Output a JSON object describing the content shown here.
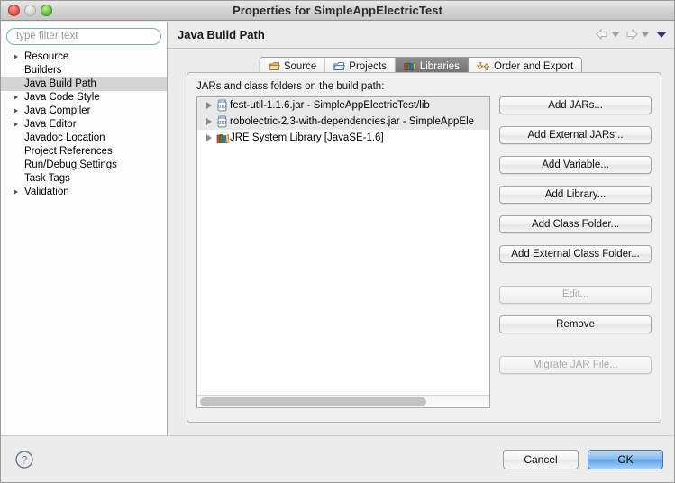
{
  "window": {
    "title": "Properties for SimpleAppElectricTest",
    "controls": [
      "close",
      "minimize",
      "zoom"
    ]
  },
  "sidebar": {
    "filter": {
      "placeholder": "type filter text",
      "value": ""
    },
    "items": [
      {
        "label": "Resource",
        "expandable": true,
        "selected": false
      },
      {
        "label": "Builders",
        "expandable": false,
        "selected": false
      },
      {
        "label": "Java Build Path",
        "expandable": false,
        "selected": true
      },
      {
        "label": "Java Code Style",
        "expandable": true,
        "selected": false
      },
      {
        "label": "Java Compiler",
        "expandable": true,
        "selected": false
      },
      {
        "label": "Java Editor",
        "expandable": true,
        "selected": false
      },
      {
        "label": "Javadoc Location",
        "expandable": false,
        "selected": false
      },
      {
        "label": "Project References",
        "expandable": false,
        "selected": false
      },
      {
        "label": "Run/Debug Settings",
        "expandable": false,
        "selected": false
      },
      {
        "label": "Task Tags",
        "expandable": false,
        "selected": false
      },
      {
        "label": "Validation",
        "expandable": true,
        "selected": false
      }
    ]
  },
  "page": {
    "title": "Java Build Path",
    "nav": {
      "back_icon": "back-arrow-icon",
      "forward_icon": "forward-arrow-icon",
      "menu_icon": "view-menu-icon"
    }
  },
  "tabs": [
    {
      "label": "Source",
      "icon": "source-folder-icon",
      "active": false
    },
    {
      "label": "Projects",
      "icon": "projects-folder-icon",
      "active": false
    },
    {
      "label": "Libraries",
      "icon": "books-icon",
      "active": true
    },
    {
      "label": "Order and Export",
      "icon": "order-export-icon",
      "active": false
    }
  ],
  "libraries": {
    "group_label": "JARs and class folders on the build path:",
    "entries": [
      {
        "label": "fest-util-1.1.6.jar - SimpleAppElectricTest/lib",
        "icon": "jar-icon",
        "expandable": true
      },
      {
        "label": "robolectric-2.3-with-dependencies.jar - SimpleAppEle",
        "icon": "jar-icon",
        "expandable": true
      },
      {
        "label": "JRE System Library [JavaSE-1.6]",
        "icon": "library-icon",
        "expandable": true
      }
    ],
    "buttons": [
      {
        "label": "Add JARs...",
        "enabled": true
      },
      {
        "label": "Add External JARs...",
        "enabled": true
      },
      {
        "label": "Add Variable...",
        "enabled": true
      },
      {
        "label": "Add Library...",
        "enabled": true
      },
      {
        "label": "Add Class Folder...",
        "enabled": true
      },
      {
        "label": "Add External Class Folder...",
        "enabled": true
      },
      {
        "label": "Edit...",
        "enabled": false
      },
      {
        "label": "Remove",
        "enabled": true
      },
      {
        "label": "Migrate JAR File...",
        "enabled": false
      }
    ]
  },
  "footer": {
    "help_icon": "help-question-icon",
    "cancel_label": "Cancel",
    "ok_label": "OK"
  },
  "colors": {
    "selection_gray": "#d4d4d4",
    "active_tab": "#7a7a7a",
    "ok_blue": "#5ba0e4",
    "filter_border": "#7ba7d7"
  }
}
